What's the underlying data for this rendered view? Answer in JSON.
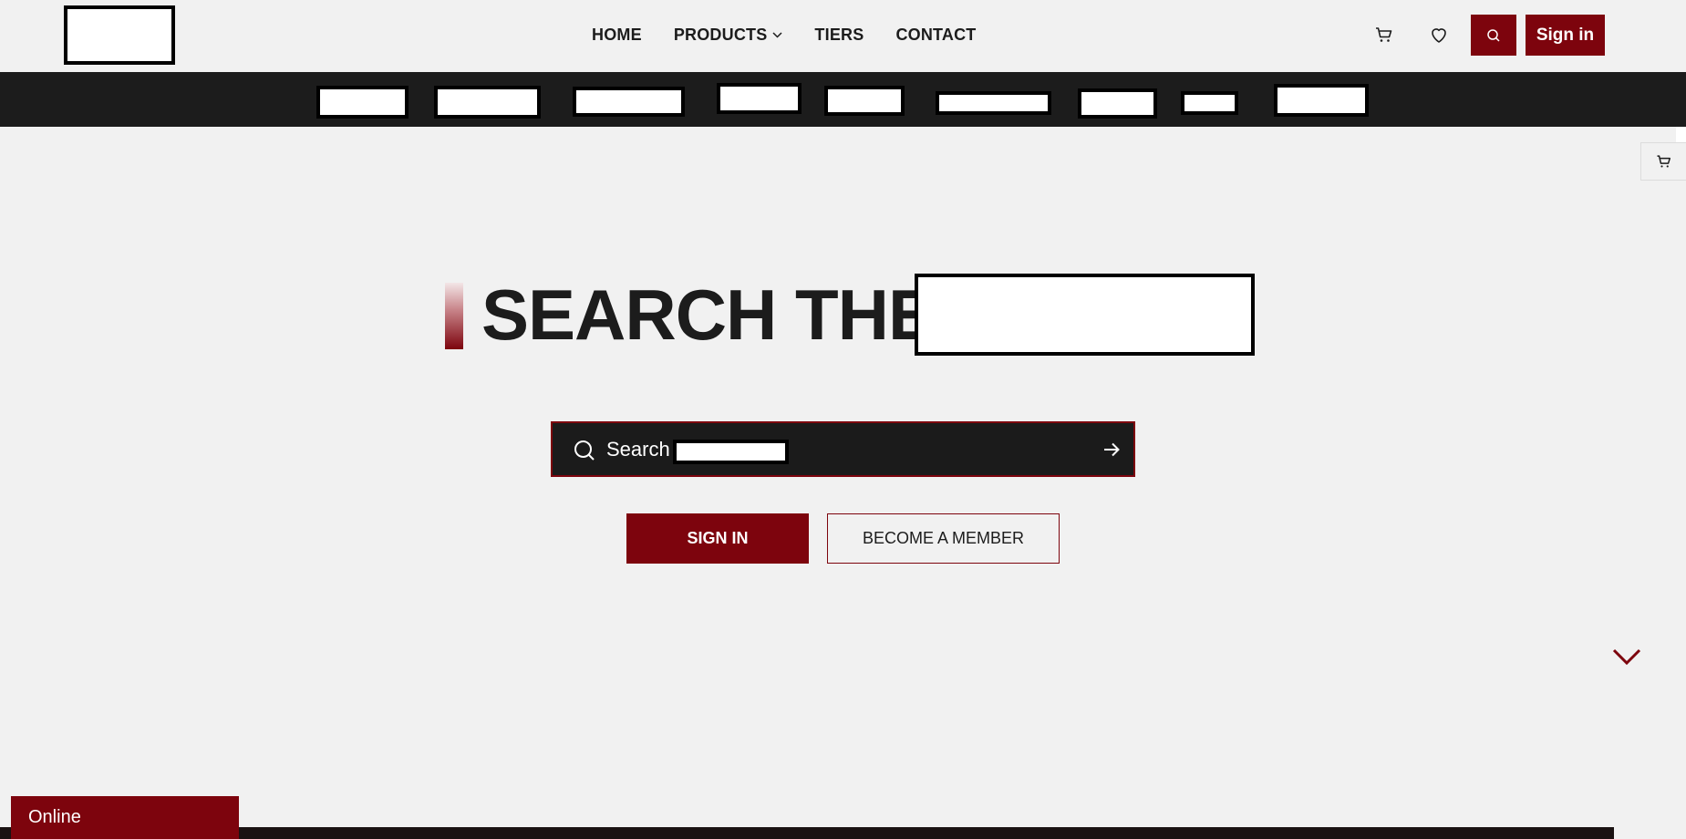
{
  "header": {
    "nav": [
      {
        "label": "HOME"
      },
      {
        "label": "PRODUCTS",
        "has_dropdown": true
      },
      {
        "label": "TIERS"
      },
      {
        "label": "CONTACT"
      }
    ],
    "signin_label": "Sign in",
    "icons": [
      "cart-icon",
      "heart-icon",
      "search-icon"
    ]
  },
  "category_bar": {
    "item_count": 9
  },
  "hero": {
    "title_prefix": "SEARCH THE",
    "search_label": "Search",
    "signin_button": "SIGN IN",
    "member_button": "BECOME A MEMBER"
  },
  "status": {
    "online_label": "Online"
  },
  "colors": {
    "accent": "#7d040d",
    "dark": "#1c1c1c",
    "background": "#f1f1f1"
  }
}
